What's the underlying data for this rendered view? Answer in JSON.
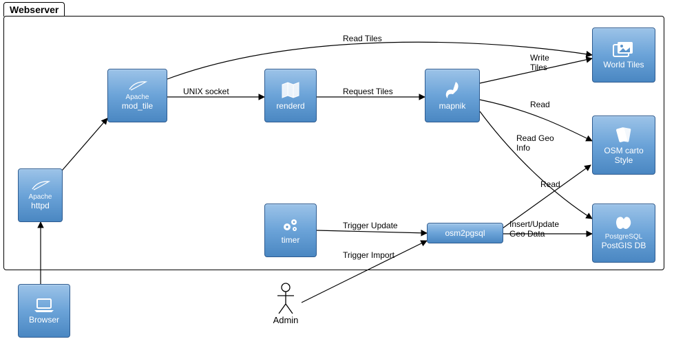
{
  "frame": {
    "title": "Webserver"
  },
  "nodes": {
    "httpd": {
      "sup": "Apache",
      "label": "httpd"
    },
    "mod_tile": {
      "sup": "Apache",
      "label": "mod_tile"
    },
    "renderd": {
      "label": "renderd"
    },
    "mapnik": {
      "label": "mapnik"
    },
    "world_tiles": {
      "label": "World Tiles"
    },
    "osm_style": {
      "label": "OSM carto\nStyle"
    },
    "postgis": {
      "sup": "PostgreSQL",
      "label": "PostGIS DB"
    },
    "timer": {
      "label": "timer"
    },
    "osm2pgsql": {
      "label": "osm2pgsql"
    },
    "browser": {
      "label": "Browser"
    }
  },
  "actor": {
    "admin": {
      "label": "Admin"
    }
  },
  "edges": {
    "browser_httpd": "",
    "httpd_modtile": "",
    "modtile_renderd": "UNIX socket",
    "renderd_mapnik": "Request Tiles",
    "modtile_world": "Read Tiles",
    "mapnik_world": "Write\nTiles",
    "mapnik_style": "Read",
    "mapnik_postgis": "Read Geo\nInfo",
    "osm2pgsql_style": "Read",
    "osm2pgsql_postgis": "Insert/Update\nGeo Data",
    "timer_osm2pgsql": "Trigger Update",
    "admin_osm2pgsql": "Trigger Import"
  }
}
